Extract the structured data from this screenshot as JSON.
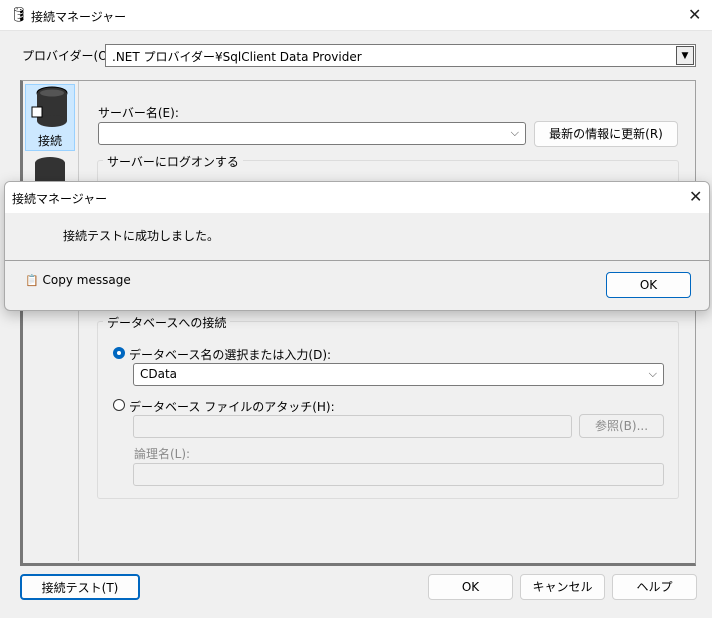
{
  "window": {
    "title": "接続マネージャー",
    "icon": "database-icon"
  },
  "provider": {
    "label": "プロバイダー(O):",
    "value": ".NET プロバイダー¥SqlClient Data Provider"
  },
  "sidebar": {
    "items": [
      {
        "label": "接続",
        "icon": "database-plug-icon",
        "selected": true
      },
      {
        "label": "",
        "icon": "database-all-icon",
        "selected": false
      }
    ]
  },
  "server": {
    "label": "サーバー名(E):",
    "value": "",
    "refresh_label": "最新の情報に更新(R)",
    "logon_group": "サーバーにログオンする"
  },
  "database": {
    "group": "データベースへの接続",
    "select_label": "データベース名の選択または入力(D):",
    "select_value": "CData",
    "attach_label": "データベース ファイルのアタッチ(H):",
    "attach_value": "",
    "browse_label": "参照(B)...",
    "logical_label": "論理名(L):",
    "logical_value": "",
    "selected_option": "select"
  },
  "footer": {
    "test_label": "接続テスト(T)",
    "ok_label": "OK",
    "cancel_label": "キャンセル",
    "help_label": "ヘルプ"
  },
  "dialog": {
    "title": "接続マネージャー",
    "message": "接続テストに成功しました。",
    "copy_label": "Copy message",
    "ok_label": "OK"
  },
  "colors": {
    "accent": "#0067c0",
    "selected_bg": "#cce8ff"
  }
}
